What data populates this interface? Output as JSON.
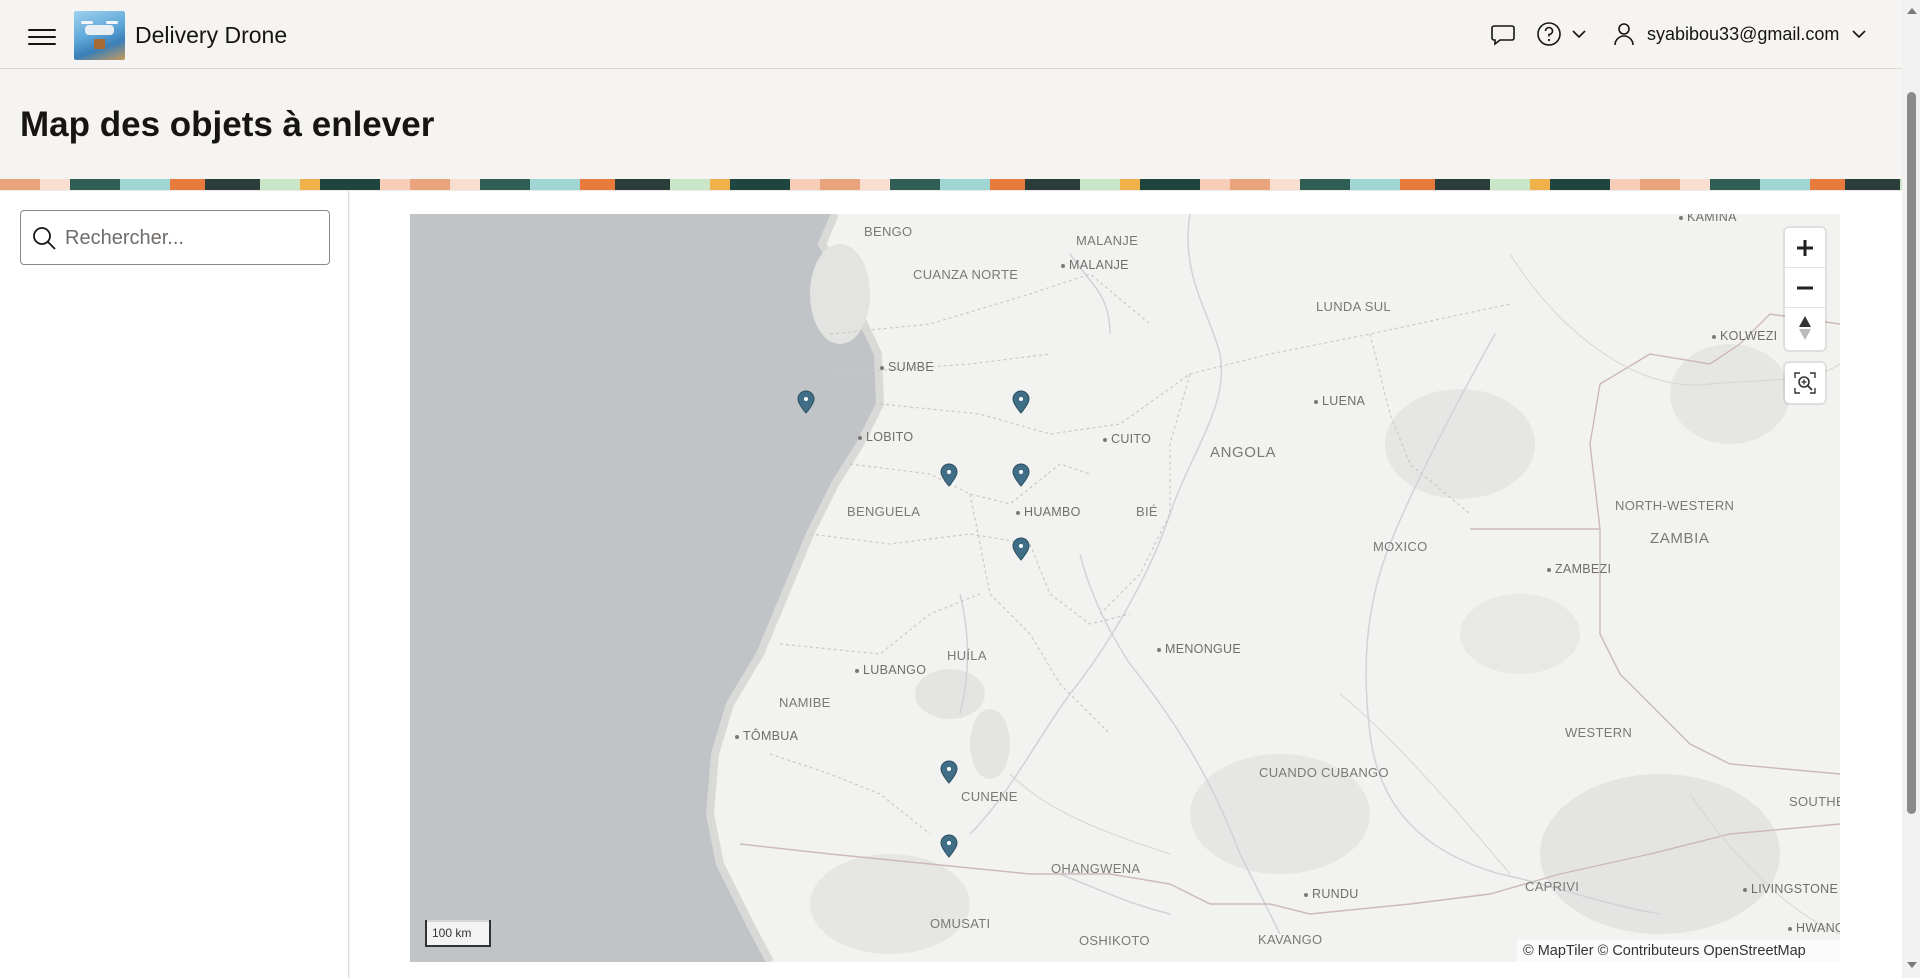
{
  "header": {
    "app_title": "Delivery Drone",
    "user_email": "syabibou33@gmail.com",
    "icons": [
      "menu-icon",
      "chat-icon",
      "help-icon",
      "user-icon"
    ]
  },
  "page": {
    "title": "Map des objets à enlever"
  },
  "sidebar": {
    "search_placeholder": "Rechercher..."
  },
  "map": {
    "places": {
      "bengo": "BENGO",
      "malanje_region": "MALANJE",
      "malanje_city": "MALANJE",
      "cuanza_norte": "CUANZA NORTE",
      "lunda_sul": "LUNDA SUL",
      "kamina": "KAMINA",
      "kolwezi": "KOLWEZI",
      "sumbe": "SUMBE",
      "angola": "ANGOLA",
      "luena": "LUENA",
      "lobito": "LOBITO",
      "cuito": "CUITO",
      "benguela": "BENGUELA",
      "huambo": "HUAMBO",
      "bie": "BIÉ",
      "north_western": "NORTH-WESTERN",
      "zambia": "ZAMBIA",
      "moxico": "MOXICO",
      "zambezi": "ZAMBEZI",
      "menongue": "MENONGUE",
      "huila": "HUÍLA",
      "lubango": "LUBANGO",
      "namibe": "NAMIBE",
      "tombua": "TÔMBUA",
      "western": "WESTERN",
      "cuando_cubango": "CUANDO CUBANGO",
      "southern": "SOUTHE",
      "cunene": "CUNENE",
      "ohangwena": "OHANGWENA",
      "caprivi": "CAPRIVI",
      "livingstone": "LIVINGSTONE",
      "rundu": "RUNDU",
      "omusati": "OMUSATI",
      "oshikoto": "OSHIKOTO",
      "kavango": "KAVANGO",
      "hwange": "HWANG"
    },
    "marker_count": 7,
    "marker_color": "#3f6e86",
    "scale_label": "100 km",
    "attribution": "© MapTiler  © Contributeurs OpenStreetMap",
    "controls": [
      "zoom-in",
      "zoom-out",
      "compass",
      "zoom-to-extent"
    ]
  }
}
